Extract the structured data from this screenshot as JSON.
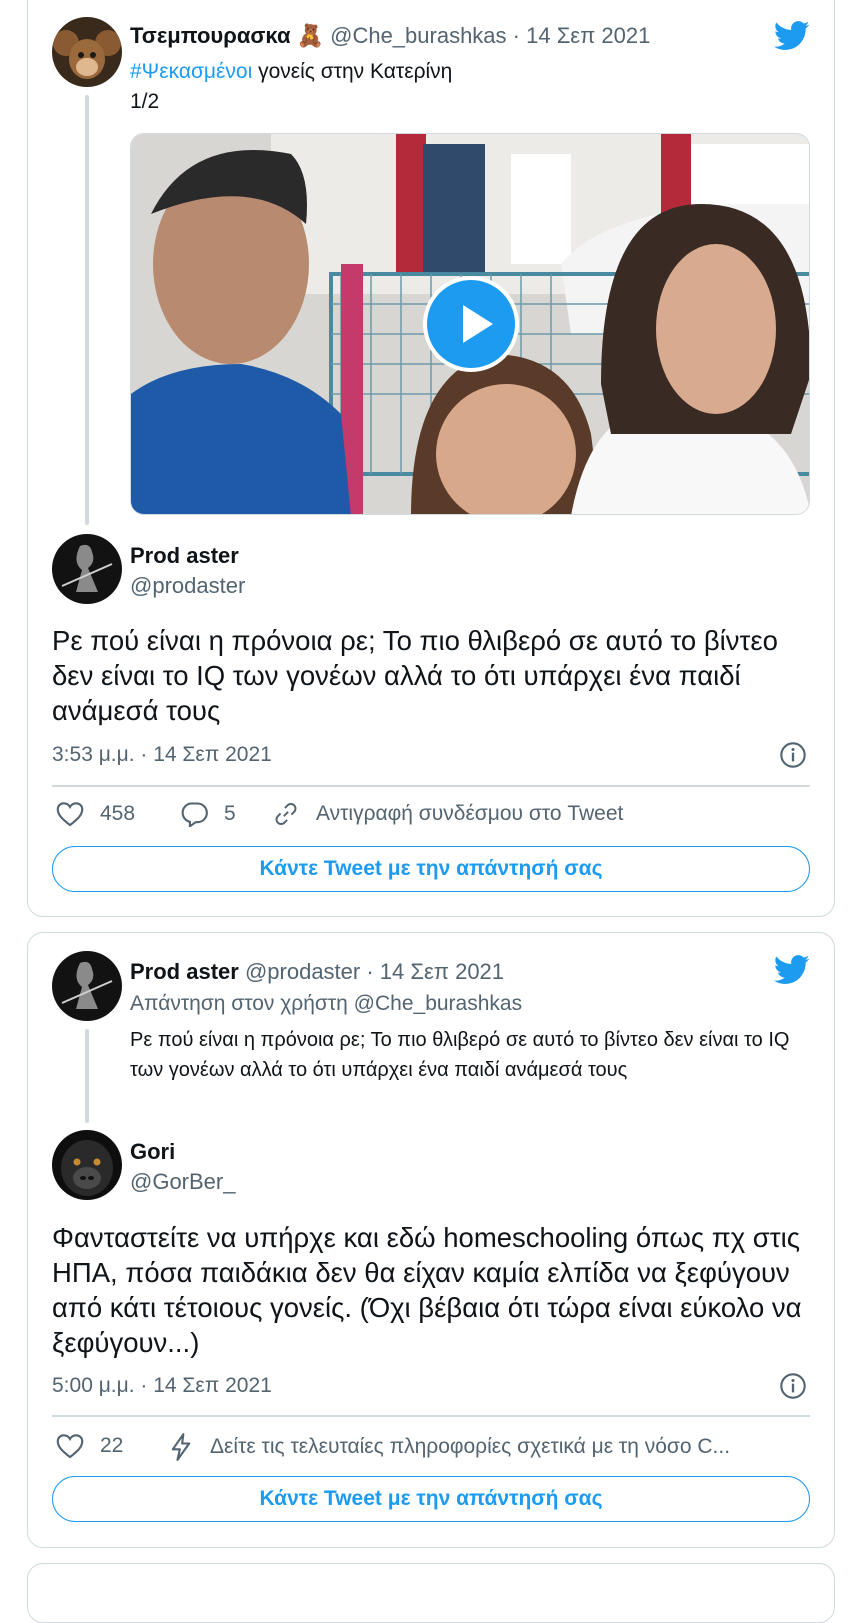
{
  "tweet1": {
    "author_name": "Τσεμπουρασκα 🧸",
    "author_handle": "@Che_burashkas",
    "date": "14 Σεπ 2021",
    "hashtag": "#Ψεκασμένοι",
    "text_after_hashtag": " γονείς στην Κατερίνη",
    "text_line2": "1/2",
    "reply": {
      "author_name": "Prod aster",
      "author_handle": "@prodaster",
      "text": "Ρε πού είναι η πρόνοια ρε; Το πιο θλιβερό σε αυτό το βίντεο δεν είναι το IQ των γονέων αλλά το ότι υπάρχει ένα παιδί ανάμεσά τους",
      "timestamp": "3:53 μ.μ. · 14 Σεπ 2021",
      "likes": "458",
      "replies": "5",
      "copy_link": "Αντιγραφή συνδέσμου στο Tweet",
      "reply_button": "Κάντε Tweet με την απάντησή σας"
    }
  },
  "tweet2": {
    "author_name": "Prod aster",
    "author_handle": "@prodaster",
    "date": "14 Σεπ 2021",
    "replying_to": "Απάντηση στον χρήστη @Che_burashkas",
    "quoted_text": "Ρε πού είναι η πρόνοια ρε; Το πιο θλιβερό σε αυτό το βίντεο δεν είναι το IQ των γονέων αλλά το ότι υπάρχει ένα παιδί ανάμεσά τους",
    "reply": {
      "author_name": "Gori",
      "author_handle": "@GorBer_",
      "text": "Φανταστείτε να υπήρχε και εδώ homeschooling όπως πχ στις ΗΠΑ, πόσα παιδάκια δεν θα είχαν καμία ελπίδα να ξεφύγουν από κάτι τέτοιους γονείς. (Όχι βέβαια ότι τώρα είναι εύκολο να ξεφύγουν...)",
      "timestamp": "5:00 μ.μ. · 14 Σεπ 2021",
      "likes": "22",
      "covid_info": "Δείτε τις τελευταίες πληροφορίες σχετικά με τη νόσο C...",
      "reply_button": "Κάντε Tweet με την απάντησή σας"
    }
  },
  "separator": " · ",
  "colors": {
    "brand": "#1d9bf0",
    "text": "#0f1419",
    "muted": "#536471",
    "border": "#cfd9de"
  },
  "icons": [
    "twitter-bird-icon",
    "heart-icon",
    "reply-bubble-icon",
    "link-icon",
    "info-icon",
    "lightning-icon",
    "play-icon"
  ]
}
